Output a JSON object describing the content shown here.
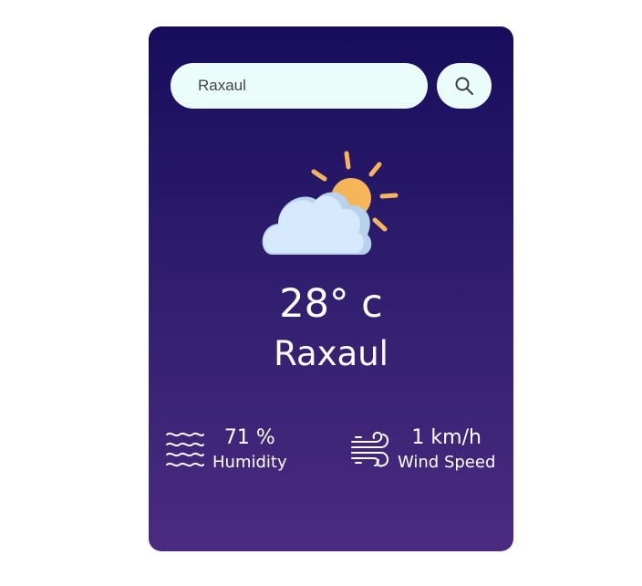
{
  "search": {
    "value": "Raxaul",
    "button_icon": "search-icon"
  },
  "weather": {
    "icon": "partly-cloudy-icon",
    "temperature": "28° c",
    "city": "Raxaul"
  },
  "details": {
    "humidity": {
      "value": "71 %",
      "label": "Humidity",
      "icon": "humidity-waves-icon"
    },
    "wind": {
      "value": "1 km/h",
      "label": "Wind Speed",
      "icon": "wind-icon"
    }
  },
  "colors": {
    "card_top": "#170c5c",
    "card_bottom": "#4a2b80",
    "search_bg": "#eafdfb",
    "sun": "#f7b55a",
    "cloud": "#d6e8fb"
  }
}
